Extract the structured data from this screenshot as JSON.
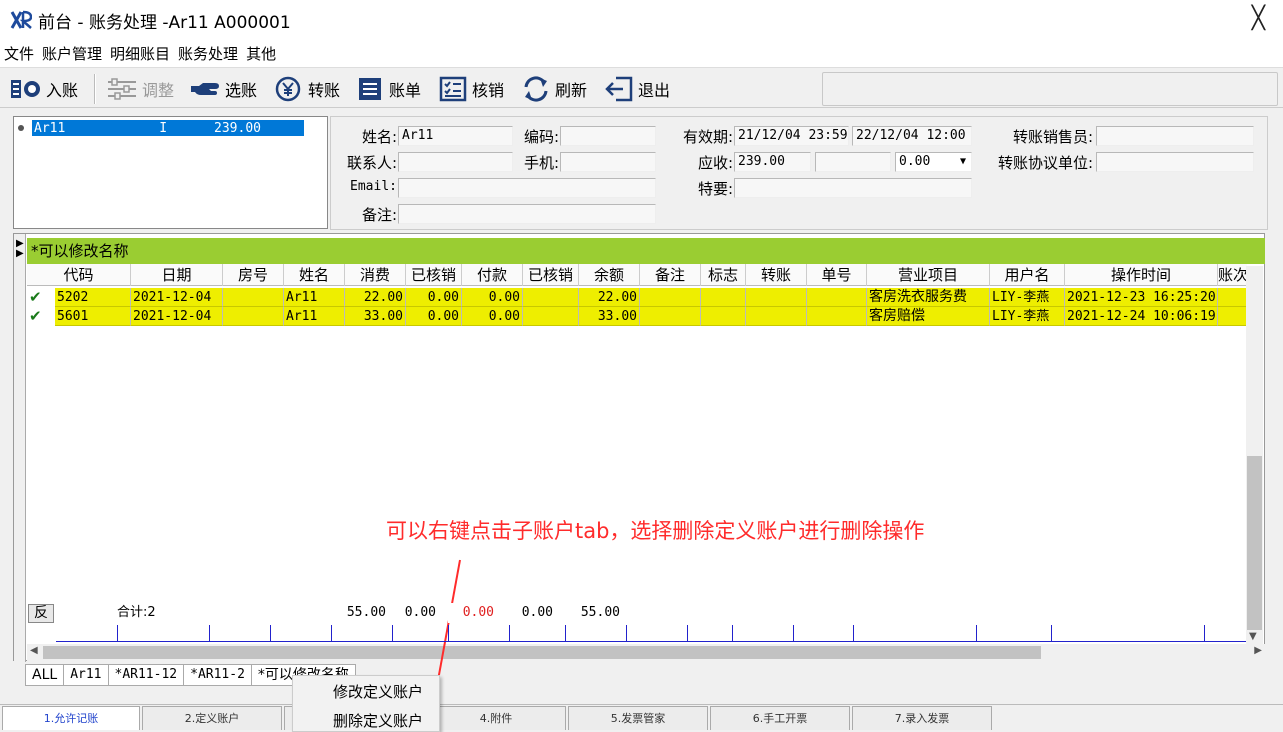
{
  "window": {
    "title": "前台 - 账务处理 -Ar11  A000001",
    "close_glyph": "╳"
  },
  "menu": [
    "文件",
    "账户管理",
    "明细账目",
    "账务处理",
    "其他"
  ],
  "toolbar": {
    "post": "入账",
    "adjust": "调整",
    "select": "选账",
    "transfer": "转账",
    "bill": "账单",
    "writeoff": "核销",
    "refresh": "刷新",
    "exit": "退出"
  },
  "account_list": {
    "item": "Ar11            I      239.00"
  },
  "info": {
    "name_label": "姓名:",
    "name_value": "Ar11",
    "code_label": "编码:",
    "code_value": "",
    "contact_label": "联系人:",
    "contact_value": "",
    "mobile_label": "手机:",
    "mobile_value": "",
    "email_label": "Email:",
    "email_value": "",
    "remark_label": "备注:",
    "remark_value": "",
    "valid_label": "有效期:",
    "valid_from": "21/12/04 23:59",
    "valid_to": "22/12/04 12:00",
    "receivable_label": "应收:",
    "receivable_value": "239.00",
    "receivable_value2": "",
    "receivable_select": "0.00",
    "special_label": "特要:",
    "special_value": "",
    "seller_label": "转账销售员:",
    "seller_value": "",
    "unit_label": "转账协议单位:",
    "unit_value": ""
  },
  "grid": {
    "group_title": "*可以修改名称",
    "columns": [
      "代码",
      "日期",
      "房号",
      "姓名",
      "消费",
      "已核销",
      "付款",
      "已核销",
      "余额",
      "备注",
      "标志",
      "转账",
      "单号",
      "营业项目",
      "用户名",
      "操作时间",
      "账次"
    ],
    "rows": [
      [
        "5202",
        "2021-12-04",
        "",
        "Ar11",
        "22.00",
        "0.00",
        "0.00",
        "",
        "22.00",
        "",
        "",
        "",
        "",
        "客房洗衣服务费",
        "LIY-李燕",
        "2021-12-23 16:25:20",
        ""
      ],
      [
        "5601",
        "2021-12-04",
        "",
        "Ar11",
        "33.00",
        "0.00",
        "0.00",
        "",
        "33.00",
        "",
        "",
        "",
        "",
        "客房赔偿",
        "LIY-李燕",
        "2021-12-24 10:06:19",
        ""
      ]
    ],
    "check_glyph": "✔",
    "reverse_button": "反",
    "totals": {
      "count": "合计:2",
      "consume": "55.00",
      "written_off": "0.00",
      "payment": "0.00",
      "written_off2": "0.00",
      "balance": "55.00"
    }
  },
  "annotation": "可以右键点击子账户tab，选择删除定义账户进行删除操作",
  "subtabs": [
    "ALL",
    "Ar11",
    "*AR11-12",
    "*AR11-2",
    "*可以修改名称"
  ],
  "context_menu": [
    "修改定义账户",
    "删除定义账户"
  ],
  "bottom_tabs": [
    "1.允许记账",
    "2.定义账户",
    "",
    "4.附件",
    "5.发票管家",
    "6.手工开票",
    "7.录入发票"
  ],
  "colors": {
    "row_bg": "#eeee00",
    "group_bg": "#9acd32",
    "annotation": "#ff2b2b",
    "selection": "#0078d7"
  }
}
